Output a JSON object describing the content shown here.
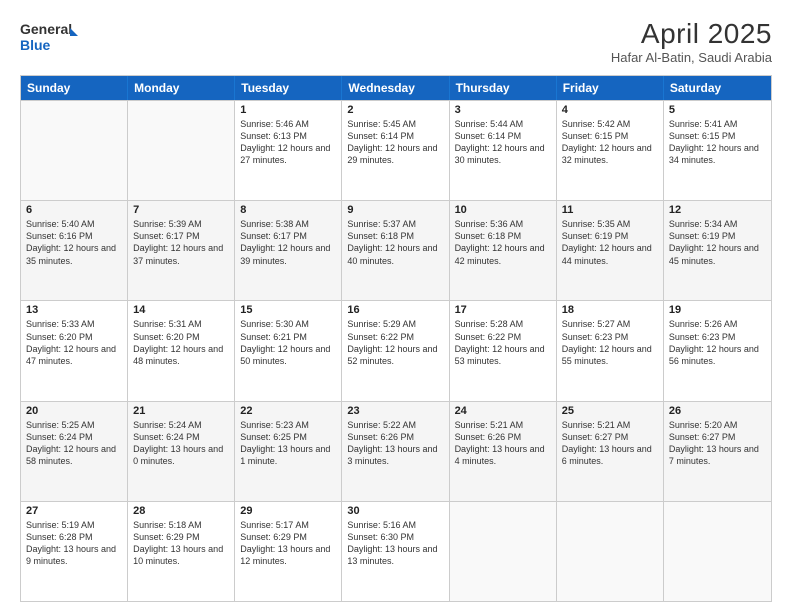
{
  "logo": {
    "line1": "General",
    "line2": "Blue"
  },
  "title": "April 2025",
  "subtitle": "Hafar Al-Batin, Saudi Arabia",
  "headers": [
    "Sunday",
    "Monday",
    "Tuesday",
    "Wednesday",
    "Thursday",
    "Friday",
    "Saturday"
  ],
  "rows": [
    [
      {
        "day": "",
        "info": ""
      },
      {
        "day": "",
        "info": ""
      },
      {
        "day": "1",
        "info": "Sunrise: 5:46 AM\nSunset: 6:13 PM\nDaylight: 12 hours and 27 minutes."
      },
      {
        "day": "2",
        "info": "Sunrise: 5:45 AM\nSunset: 6:14 PM\nDaylight: 12 hours and 29 minutes."
      },
      {
        "day": "3",
        "info": "Sunrise: 5:44 AM\nSunset: 6:14 PM\nDaylight: 12 hours and 30 minutes."
      },
      {
        "day": "4",
        "info": "Sunrise: 5:42 AM\nSunset: 6:15 PM\nDaylight: 12 hours and 32 minutes."
      },
      {
        "day": "5",
        "info": "Sunrise: 5:41 AM\nSunset: 6:15 PM\nDaylight: 12 hours and 34 minutes."
      }
    ],
    [
      {
        "day": "6",
        "info": "Sunrise: 5:40 AM\nSunset: 6:16 PM\nDaylight: 12 hours and 35 minutes."
      },
      {
        "day": "7",
        "info": "Sunrise: 5:39 AM\nSunset: 6:17 PM\nDaylight: 12 hours and 37 minutes."
      },
      {
        "day": "8",
        "info": "Sunrise: 5:38 AM\nSunset: 6:17 PM\nDaylight: 12 hours and 39 minutes."
      },
      {
        "day": "9",
        "info": "Sunrise: 5:37 AM\nSunset: 6:18 PM\nDaylight: 12 hours and 40 minutes."
      },
      {
        "day": "10",
        "info": "Sunrise: 5:36 AM\nSunset: 6:18 PM\nDaylight: 12 hours and 42 minutes."
      },
      {
        "day": "11",
        "info": "Sunrise: 5:35 AM\nSunset: 6:19 PM\nDaylight: 12 hours and 44 minutes."
      },
      {
        "day": "12",
        "info": "Sunrise: 5:34 AM\nSunset: 6:19 PM\nDaylight: 12 hours and 45 minutes."
      }
    ],
    [
      {
        "day": "13",
        "info": "Sunrise: 5:33 AM\nSunset: 6:20 PM\nDaylight: 12 hours and 47 minutes."
      },
      {
        "day": "14",
        "info": "Sunrise: 5:31 AM\nSunset: 6:20 PM\nDaylight: 12 hours and 48 minutes."
      },
      {
        "day": "15",
        "info": "Sunrise: 5:30 AM\nSunset: 6:21 PM\nDaylight: 12 hours and 50 minutes."
      },
      {
        "day": "16",
        "info": "Sunrise: 5:29 AM\nSunset: 6:22 PM\nDaylight: 12 hours and 52 minutes."
      },
      {
        "day": "17",
        "info": "Sunrise: 5:28 AM\nSunset: 6:22 PM\nDaylight: 12 hours and 53 minutes."
      },
      {
        "day": "18",
        "info": "Sunrise: 5:27 AM\nSunset: 6:23 PM\nDaylight: 12 hours and 55 minutes."
      },
      {
        "day": "19",
        "info": "Sunrise: 5:26 AM\nSunset: 6:23 PM\nDaylight: 12 hours and 56 minutes."
      }
    ],
    [
      {
        "day": "20",
        "info": "Sunrise: 5:25 AM\nSunset: 6:24 PM\nDaylight: 12 hours and 58 minutes."
      },
      {
        "day": "21",
        "info": "Sunrise: 5:24 AM\nSunset: 6:24 PM\nDaylight: 13 hours and 0 minutes."
      },
      {
        "day": "22",
        "info": "Sunrise: 5:23 AM\nSunset: 6:25 PM\nDaylight: 13 hours and 1 minute."
      },
      {
        "day": "23",
        "info": "Sunrise: 5:22 AM\nSunset: 6:26 PM\nDaylight: 13 hours and 3 minutes."
      },
      {
        "day": "24",
        "info": "Sunrise: 5:21 AM\nSunset: 6:26 PM\nDaylight: 13 hours and 4 minutes."
      },
      {
        "day": "25",
        "info": "Sunrise: 5:21 AM\nSunset: 6:27 PM\nDaylight: 13 hours and 6 minutes."
      },
      {
        "day": "26",
        "info": "Sunrise: 5:20 AM\nSunset: 6:27 PM\nDaylight: 13 hours and 7 minutes."
      }
    ],
    [
      {
        "day": "27",
        "info": "Sunrise: 5:19 AM\nSunset: 6:28 PM\nDaylight: 13 hours and 9 minutes."
      },
      {
        "day": "28",
        "info": "Sunrise: 5:18 AM\nSunset: 6:29 PM\nDaylight: 13 hours and 10 minutes."
      },
      {
        "day": "29",
        "info": "Sunrise: 5:17 AM\nSunset: 6:29 PM\nDaylight: 13 hours and 12 minutes."
      },
      {
        "day": "30",
        "info": "Sunrise: 5:16 AM\nSunset: 6:30 PM\nDaylight: 13 hours and 13 minutes."
      },
      {
        "day": "",
        "info": ""
      },
      {
        "day": "",
        "info": ""
      },
      {
        "day": "",
        "info": ""
      }
    ]
  ]
}
